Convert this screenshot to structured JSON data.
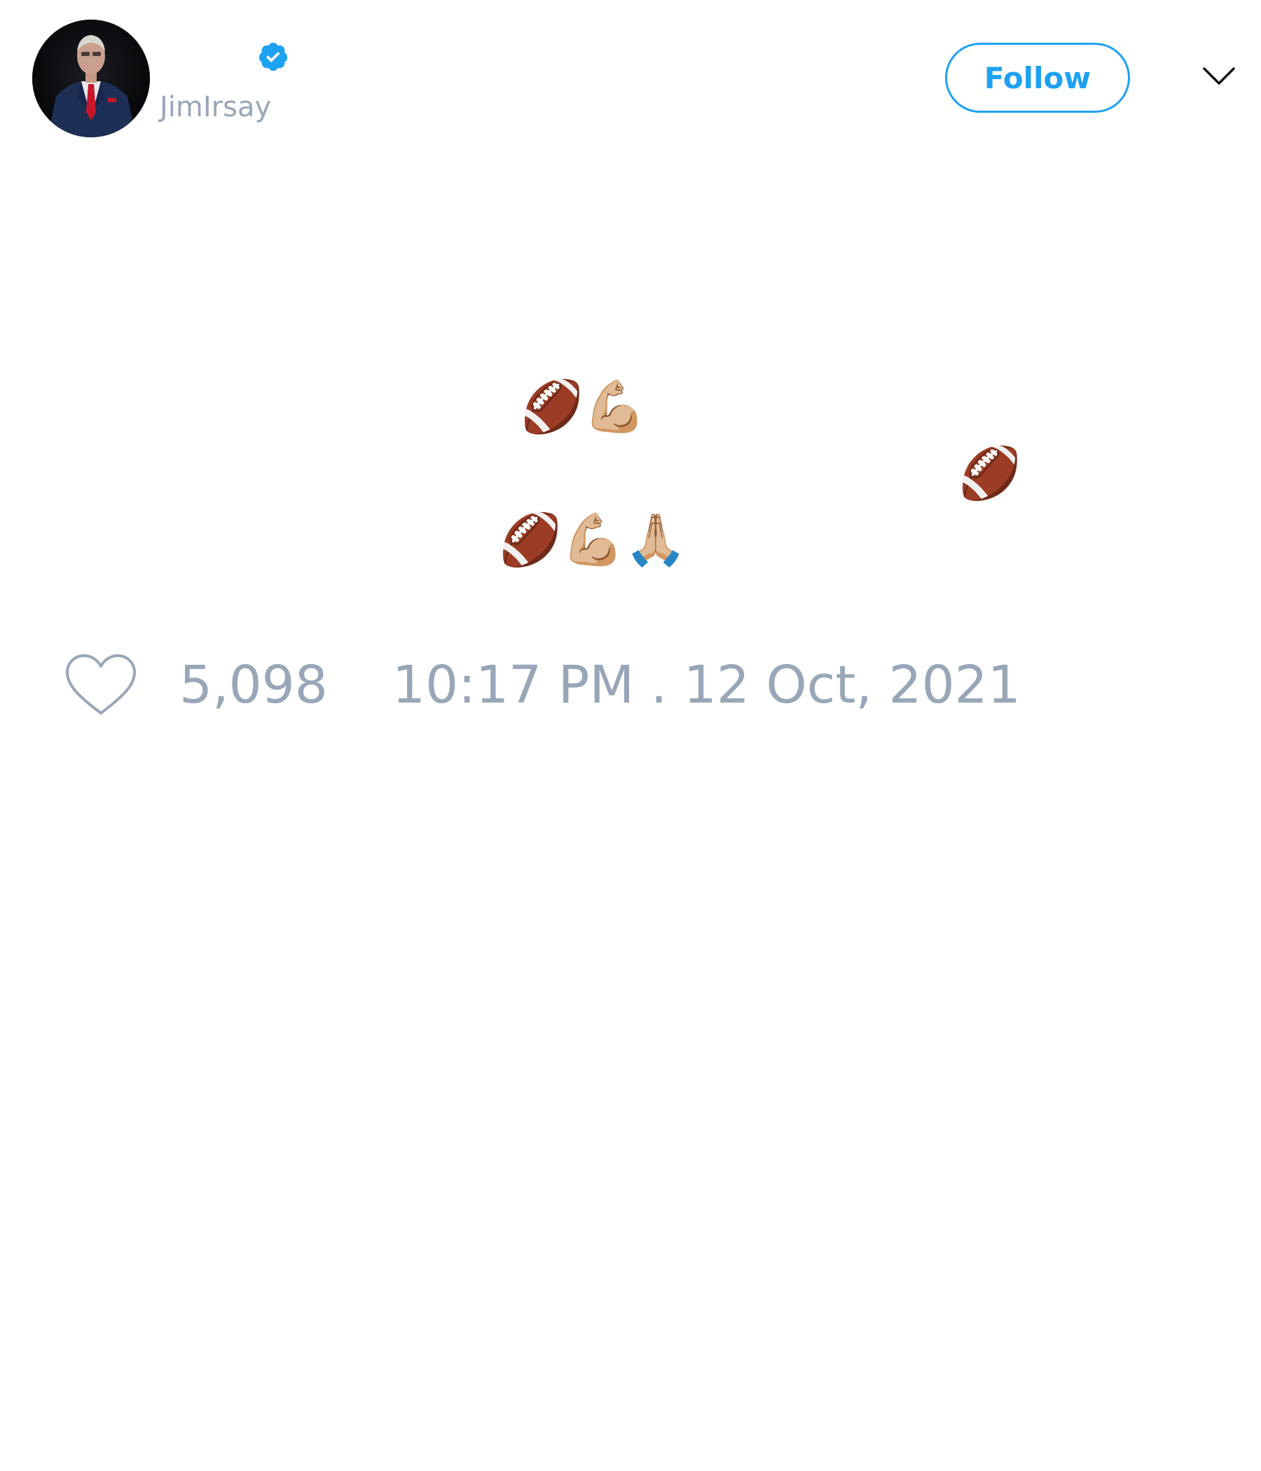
{
  "tweet": {
    "author": {
      "display_name": "",
      "handle": "JimIrsay",
      "verified": true,
      "avatar_icon": "avatar-man-in-suit-red-tie"
    },
    "follow_label": "Follow",
    "menu_icon": "chevron-down-icon",
    "body_lines": [
      "🏈💪🏼",
      "🏈",
      "🏈💪🏼🙏🏼"
    ],
    "like_icon": "heart-outline-icon",
    "like_count": "5,098",
    "timestamp": "10:17 PM . 12 Oct, 2021"
  },
  "colors": {
    "accent": "#1da1f2",
    "muted_text": "#98a6b8",
    "background": "#ffffff"
  }
}
